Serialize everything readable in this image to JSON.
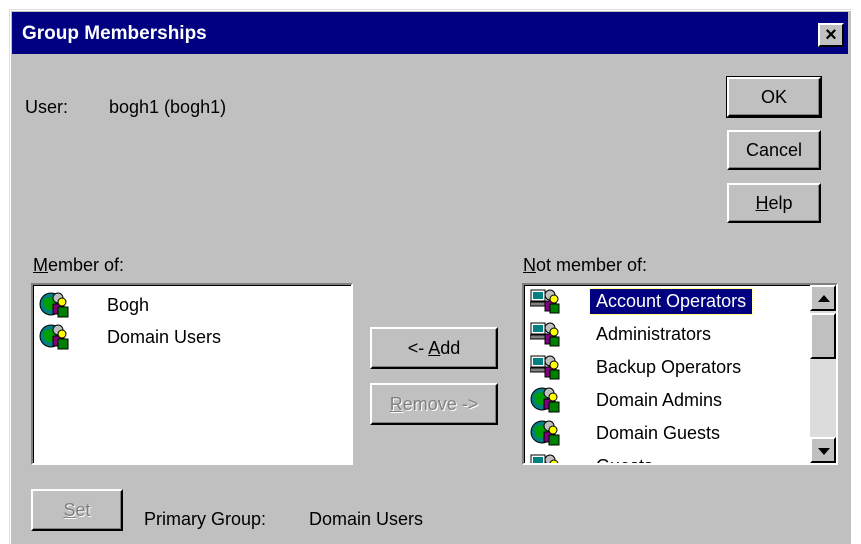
{
  "window": {
    "title": "Group Memberships",
    "close_label": "×"
  },
  "user": {
    "label": "User:",
    "value": "bogh1 (bogh1)"
  },
  "buttons": {
    "ok": "OK",
    "cancel": "Cancel",
    "help_u": "H",
    "help_rest": "elp",
    "add_prefix": "<- ",
    "add_u": "A",
    "add_rest": "dd",
    "remove_u": "R",
    "remove_rest": "emove ->",
    "set_u": "S",
    "set_rest": "et"
  },
  "member_of": {
    "label_u": "M",
    "label_rest": "ember of:",
    "items": [
      {
        "label": "Bogh",
        "icon": "global-group-icon"
      },
      {
        "label": "Domain Users",
        "icon": "global-group-icon"
      }
    ]
  },
  "not_member_of": {
    "label_u": "N",
    "label_rest": "ot member of:",
    "items": [
      {
        "label": "Account Operators",
        "icon": "local-group-icon",
        "selected": true
      },
      {
        "label": "Administrators",
        "icon": "local-group-icon"
      },
      {
        "label": "Backup Operators",
        "icon": "local-group-icon"
      },
      {
        "label": "Domain Admins",
        "icon": "global-group-icon"
      },
      {
        "label": "Domain Guests",
        "icon": "global-group-icon"
      },
      {
        "label": "Guests",
        "icon": "local-group-icon"
      }
    ]
  },
  "primary_group": {
    "label": "Primary Group:",
    "value": "Domain Users"
  },
  "colors": {
    "title_bar": "#000080",
    "face": "#c0c0c0",
    "selection": "#000080"
  }
}
